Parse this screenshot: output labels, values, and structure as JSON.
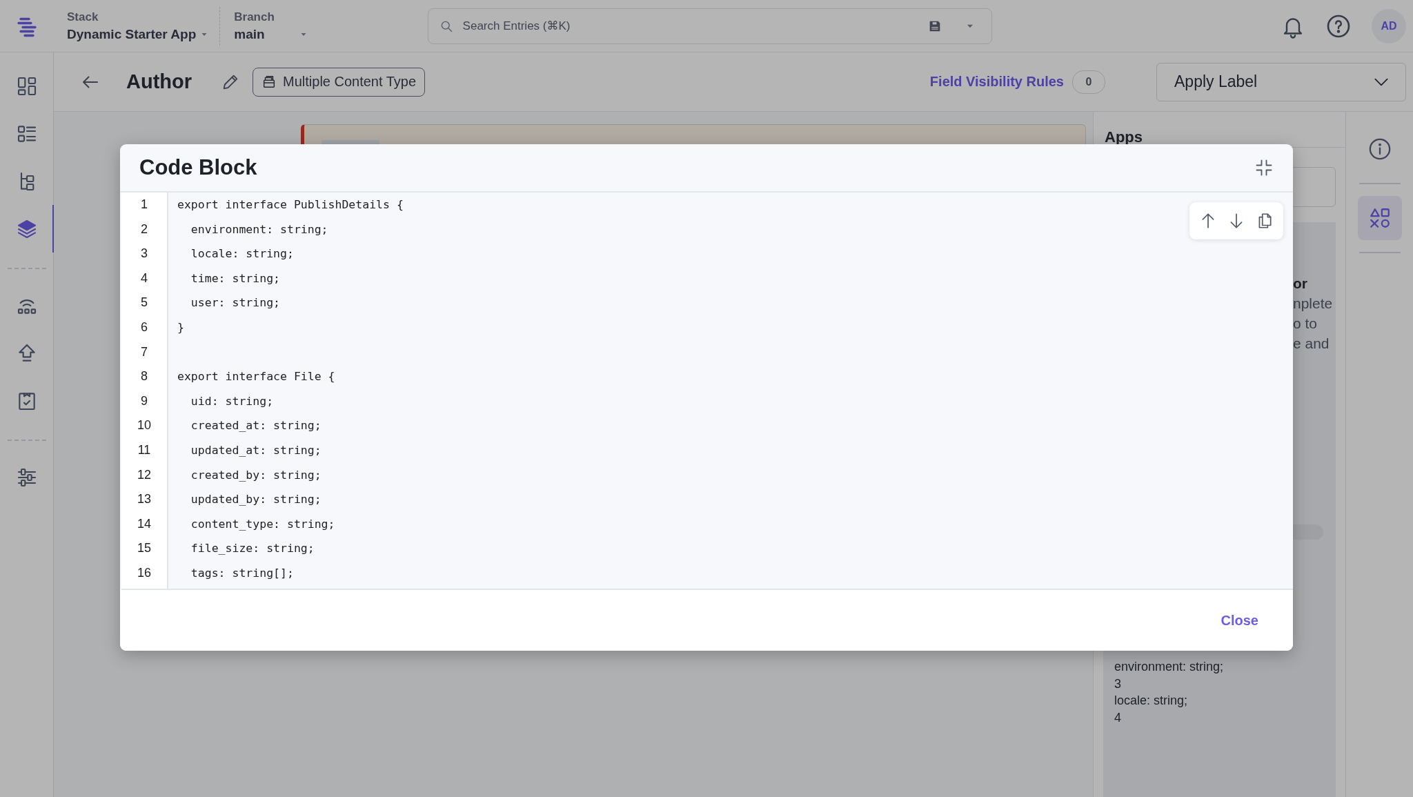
{
  "topbar": {
    "stack_label": "Stack",
    "stack_name": "Dynamic Starter App",
    "branch_label": "Branch",
    "branch_name": "main",
    "search": {
      "placeholder": "Search Entries (⌘K)"
    },
    "avatar": "AD"
  },
  "sidebar": {
    "groups": [
      {
        "items": [
          {
            "kind": "dashboard",
            "selected": false
          },
          {
            "kind": "entries",
            "selected": false
          },
          {
            "kind": "tree",
            "selected": false
          },
          {
            "kind": "layers",
            "selected": true
          }
        ]
      },
      {
        "items": [
          {
            "kind": "signal",
            "selected": false
          },
          {
            "kind": "upload",
            "selected": false
          },
          {
            "kind": "clipboard",
            "selected": false
          }
        ]
      },
      {
        "items": [
          {
            "kind": "sliders",
            "selected": false
          }
        ]
      }
    ]
  },
  "header": {
    "title": "Author",
    "content_type_button": "Multiple Content Type",
    "visibility_rules": {
      "label": "Field Visibility Rules",
      "count": "0"
    },
    "label_dropdown": "Apply Label"
  },
  "apps_panel": {
    "title": "Apps",
    "fragments": [
      "or",
      "nplete",
      "o to",
      "e and"
    ],
    "code_lines": [
      "environment: string;",
      "3",
      "locale: string;",
      "4"
    ]
  },
  "right_rail": {
    "items": [
      {
        "kind": "info",
        "selected": false
      },
      {
        "kind": "apps",
        "selected": true
      }
    ]
  },
  "modal": {
    "title": "Code Block",
    "lines": [
      {
        "number": "1",
        "code": "export interface PublishDetails {"
      },
      {
        "number": "2",
        "code": "  environment: string;"
      },
      {
        "number": "3",
        "code": "  locale: string;"
      },
      {
        "number": "4",
        "code": "  time: string;"
      },
      {
        "number": "5",
        "code": "  user: string;"
      },
      {
        "number": "6",
        "code": "}"
      },
      {
        "number": "7"
      },
      {
        "number": "8",
        "code": "export interface File {"
      },
      {
        "number": "9",
        "code": "  uid: string;"
      },
      {
        "number": "10",
        "code": "  created_at: string;"
      },
      {
        "number": "11",
        "code": "  updated_at: string;"
      },
      {
        "number": "12",
        "code": "  created_by: string;"
      },
      {
        "number": "13",
        "code": "  updated_by: string;"
      },
      {
        "number": "14",
        "code": "  content_type: string;"
      },
      {
        "number": "15",
        "code": "  file_size: string;"
      },
      {
        "number": "16",
        "code": "  tags: string[];"
      }
    ],
    "close": "Close"
  }
}
